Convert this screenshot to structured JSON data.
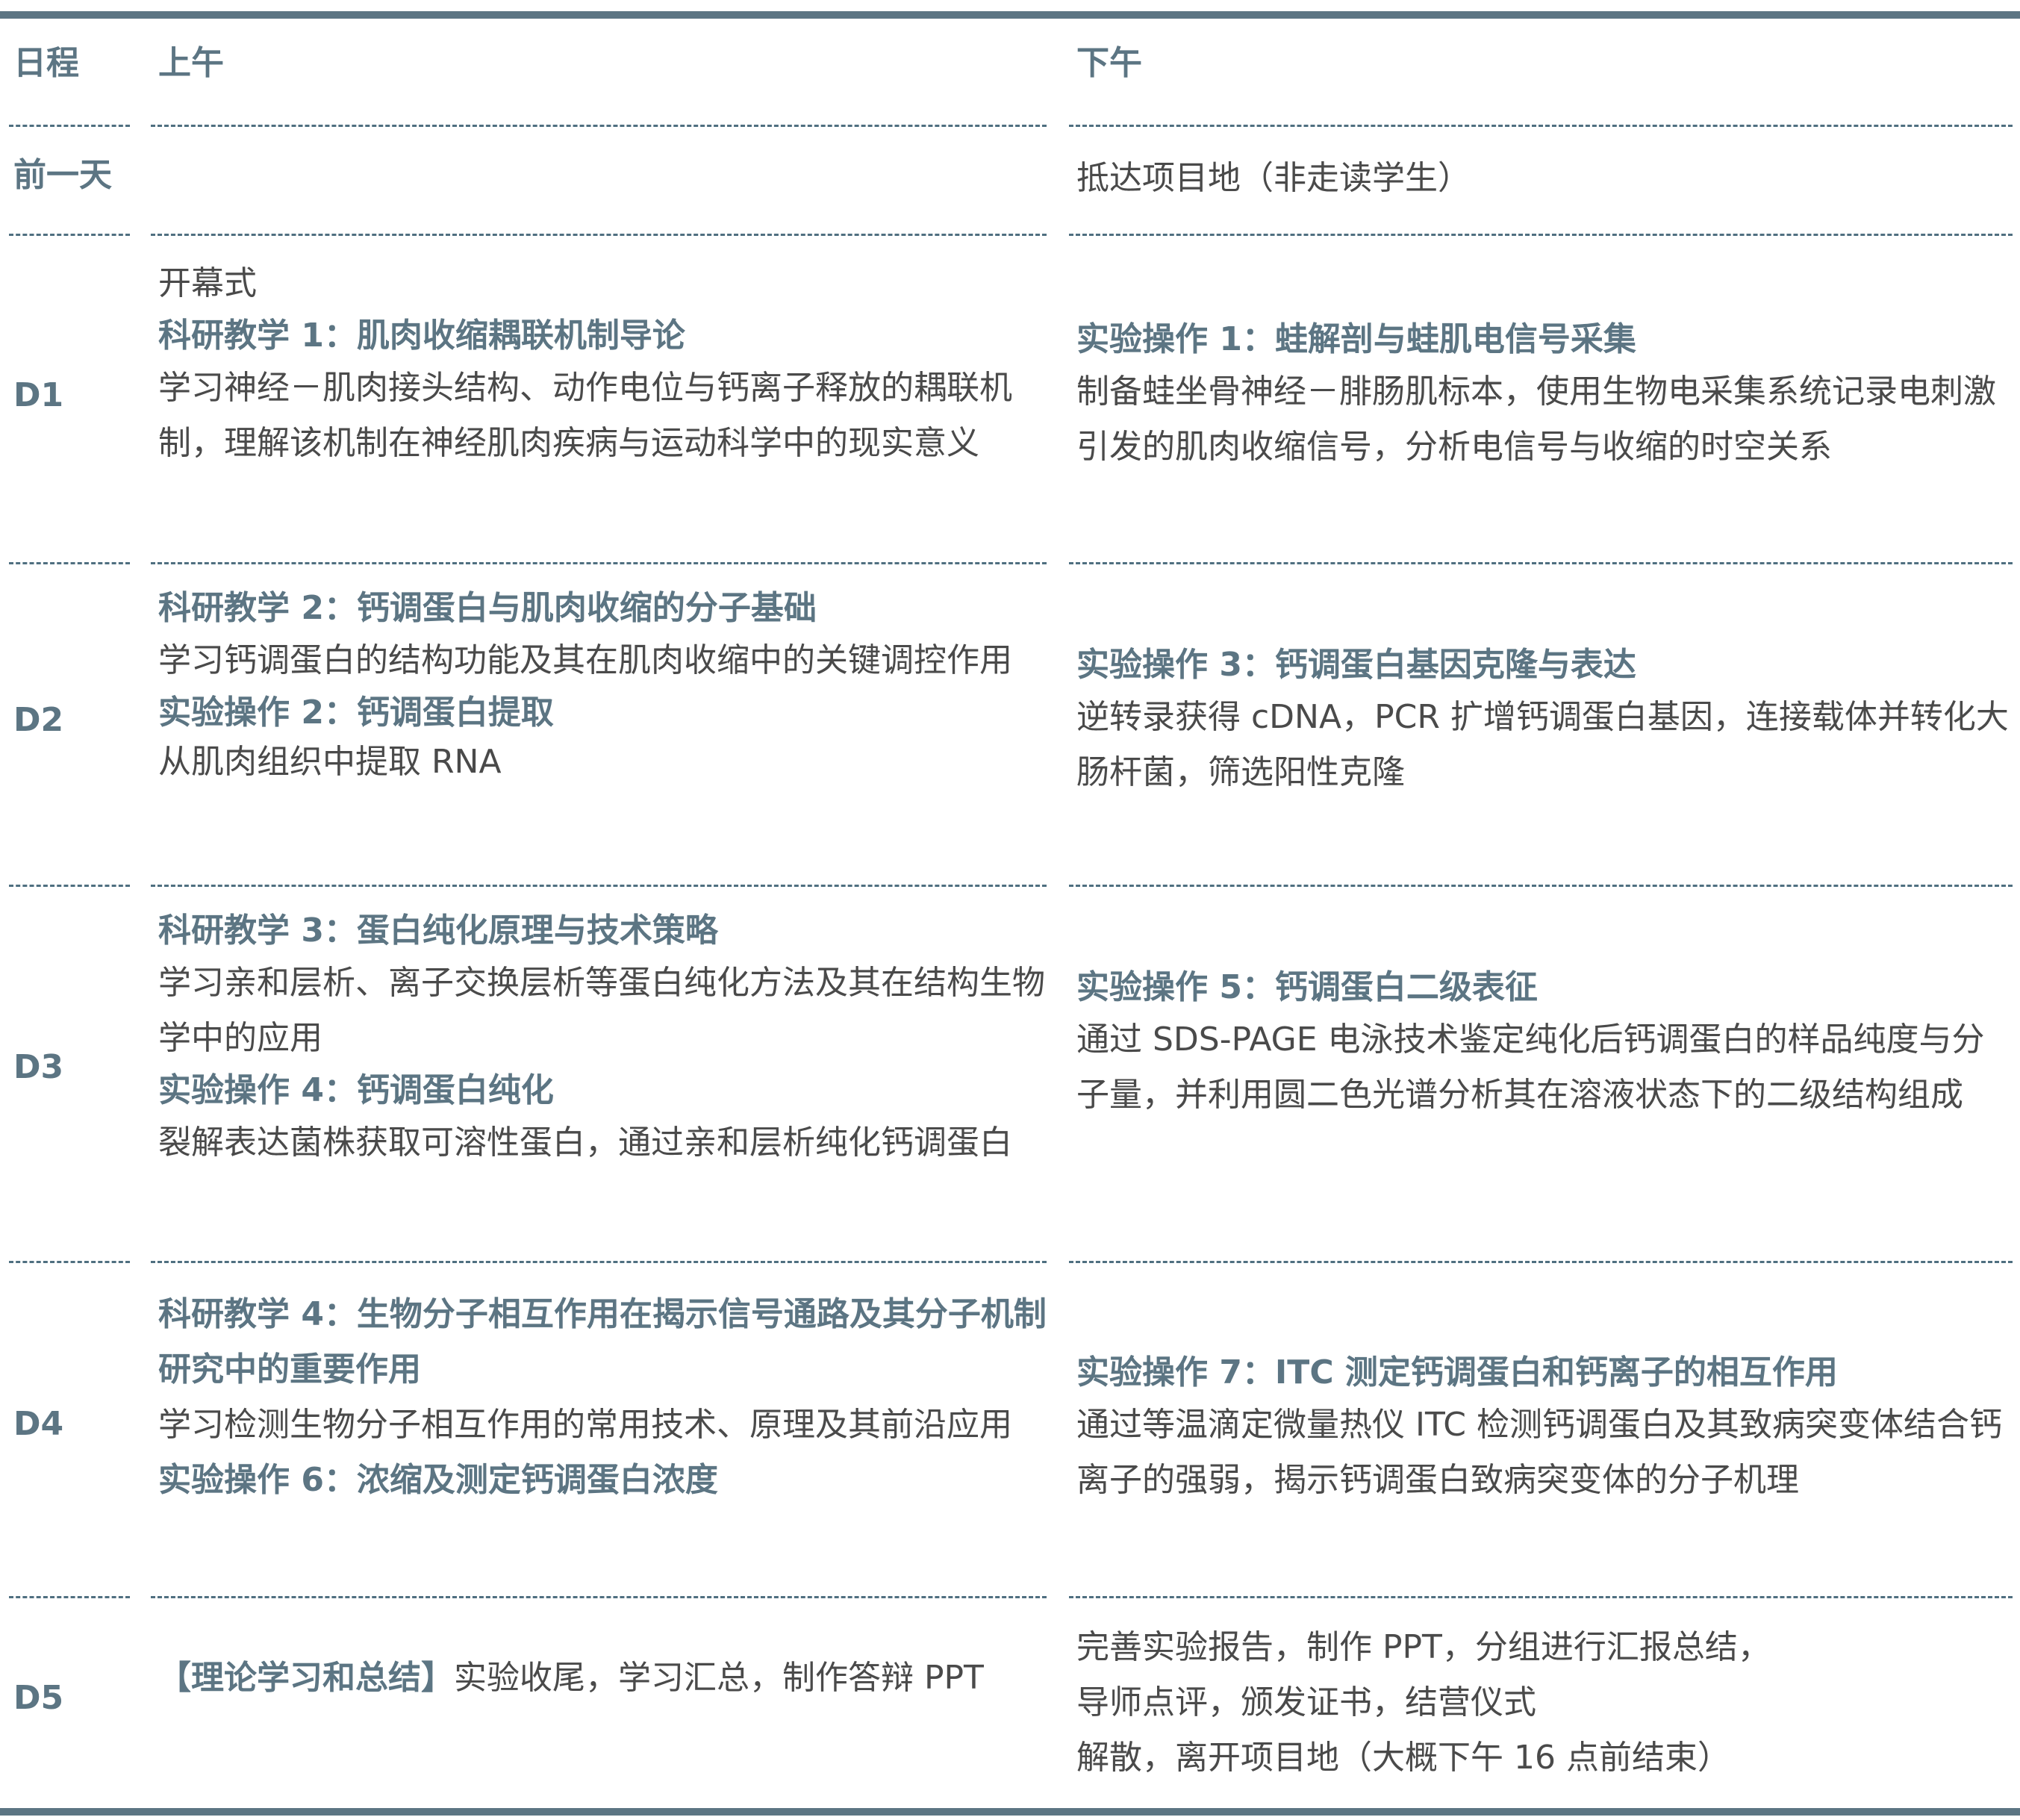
{
  "header": {
    "schedule": "日程",
    "morning": "上午",
    "afternoon": "下午"
  },
  "rows": {
    "pre": {
      "day": "前一天",
      "pm": "抵达项目地（非走读学生）"
    },
    "d1": {
      "day": "D1",
      "am_opening": "开幕式",
      "am_title": "科研教学 1：肌肉收缩耦联机制导论",
      "am_body": "学习神经－肌肉接头结构、动作电位与钙离子释放的耦联机制，理解该机制在神经肌肉疾病与运动科学中的现实意义",
      "pm_title": "实验操作 1：蛙解剖与蛙肌电信号采集",
      "pm_body": "制备蛙坐骨神经－腓肠肌标本，使用生物电采集系统记录电刺激引发的肌肉收缩信号，分析电信号与收缩的时空关系"
    },
    "d2": {
      "day": "D2",
      "am_title": "科研教学 2：钙调蛋白与肌肉收缩的分子基础",
      "am_body": "学习钙调蛋白的结构功能及其在肌肉收缩中的关键调控作用",
      "am_title2": "实验操作 2：钙调蛋白提取",
      "am_body2": "从肌肉组织中提取 RNA",
      "pm_title": "实验操作 3：钙调蛋白基因克隆与表达",
      "pm_body": "逆转录获得 cDNA，PCR 扩增钙调蛋白基因，连接载体并转化大肠杆菌，筛选阳性克隆"
    },
    "d3": {
      "day": "D3",
      "am_title": "科研教学 3：蛋白纯化原理与技术策略",
      "am_body": "学习亲和层析、离子交换层析等蛋白纯化方法及其在结构生物学中的应用",
      "am_title2": "实验操作 4：钙调蛋白纯化",
      "am_body2": "裂解表达菌株获取可溶性蛋白，通过亲和层析纯化钙调蛋白",
      "pm_title": "实验操作 5：钙调蛋白二级表征",
      "pm_body": "通过 SDS-PAGE 电泳技术鉴定纯化后钙调蛋白的样品纯度与分子量，并利用圆二色光谱分析其在溶液状态下的二级结构组成"
    },
    "d4": {
      "day": "D4",
      "am_title": "科研教学 4：生物分子相互作用在揭示信号通路及其分子机制研究中的重要作用",
      "am_body": "学习检测生物分子相互作用的常用技术、原理及其前沿应用",
      "am_title2": "实验操作 6：浓缩及测定钙调蛋白浓度",
      "pm_title": "实验操作 7：ITC 测定钙调蛋白和钙离子的相互作用",
      "pm_body": "通过等温滴定微量热仪 ITC 检测钙调蛋白及其致病突变体结合钙离子的强弱，揭示钙调蛋白致病突变体的分子机理"
    },
    "d5": {
      "day": "D5",
      "am_bold": "【理论学习和总结】",
      "am_body": "实验收尾，学习汇总，制作答辩 PPT",
      "pm_line1": "完善实验报告，制作 PPT，分组进行汇报总结，",
      "pm_line2": "导师点评，颁发证书，结营仪式",
      "pm_line3": "解散，离开项目地（大概下午 16 点前结束）"
    }
  }
}
